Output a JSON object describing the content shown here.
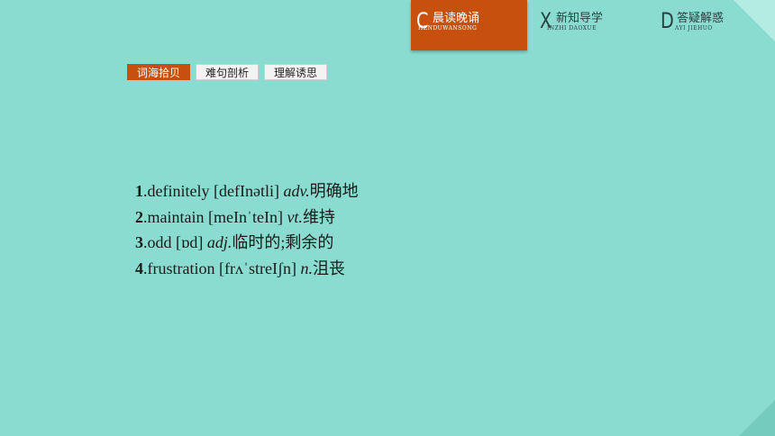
{
  "nav": {
    "tabs": [
      {
        "letter": "C",
        "label": "晨读晚诵",
        "pinyin": "HENDUWANSONG",
        "active": true
      },
      {
        "letter": "X",
        "label": "新知导学",
        "pinyin": "INZHI DAOXUE",
        "active": false
      },
      {
        "letter": "D",
        "label": "答疑解惑",
        "pinyin": "AYI JIEHUO",
        "active": false
      }
    ]
  },
  "subtabs": [
    {
      "label": "词海拾贝",
      "active": true
    },
    {
      "label": "难句剖析",
      "active": false
    },
    {
      "label": "理解诱思",
      "active": false
    }
  ],
  "vocab": [
    {
      "num": "1",
      "word": ".definitely ",
      "phonetic": "[defInətli] ",
      "pos": "adv.",
      "meaning": "明确地"
    },
    {
      "num": "2",
      "word": ".maintain ",
      "phonetic": "[meInˈteIn] ",
      "pos": "vt.",
      "meaning": "维持"
    },
    {
      "num": "3",
      "word": ".odd ",
      "phonetic": "[ɒd] ",
      "pos": "adj.",
      "meaning": "临时的;剩余的"
    },
    {
      "num": "4",
      "word": ".frustration ",
      "phonetic": "[frʌˈstreIʃn] ",
      "pos": "n.",
      "meaning": "沮丧"
    }
  ]
}
